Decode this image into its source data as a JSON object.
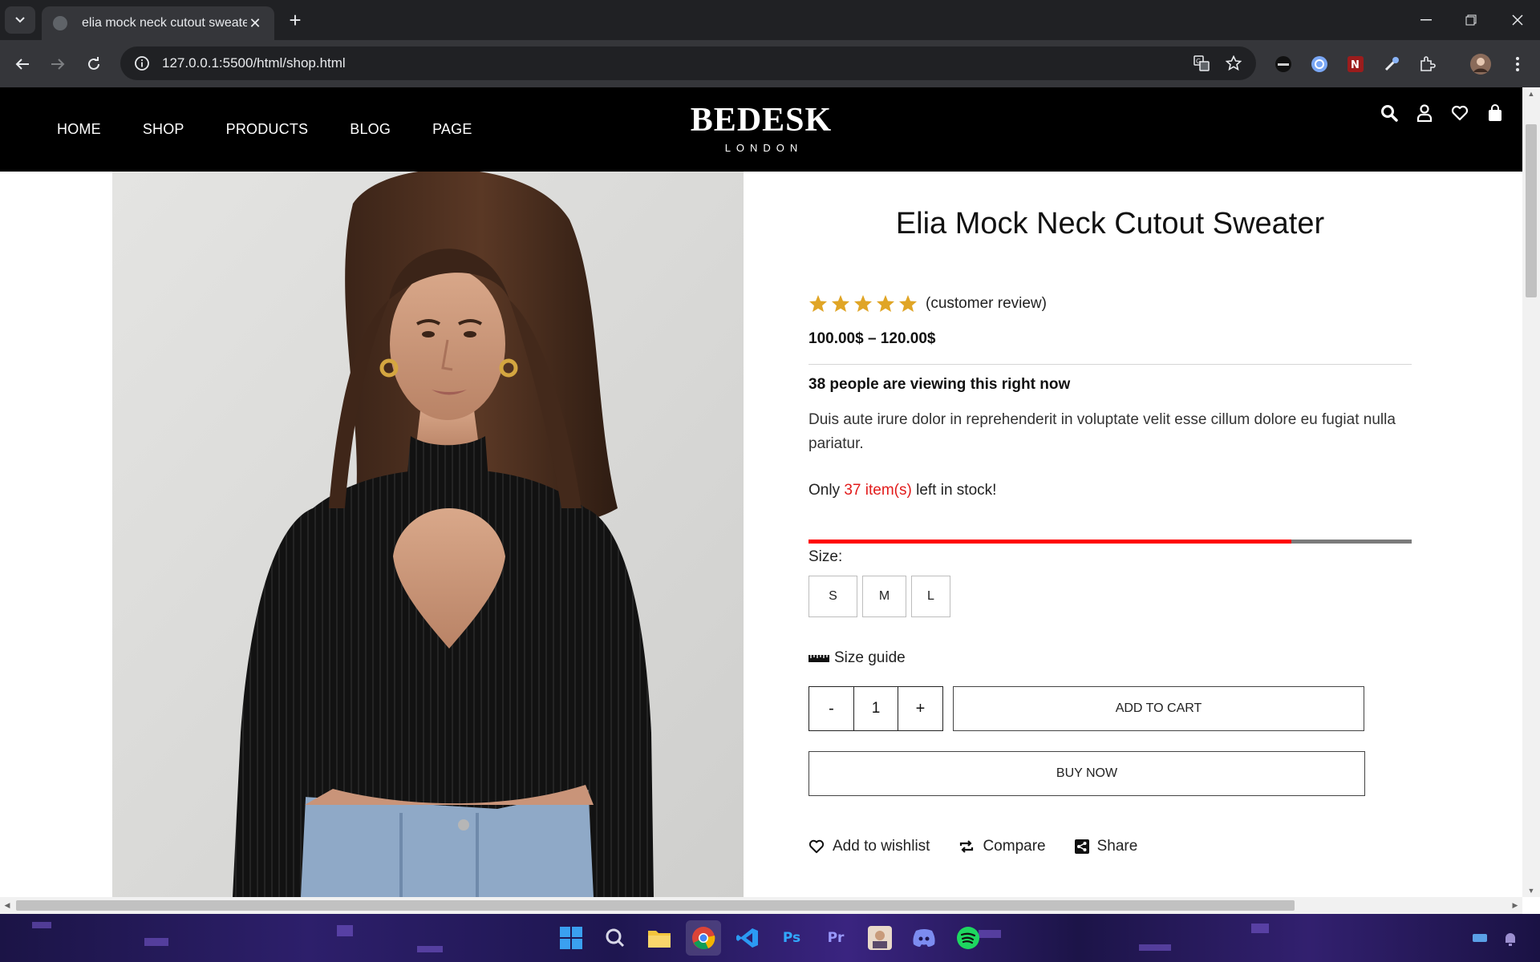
{
  "browser": {
    "tab_title": "elia mock neck cutout sweater",
    "url": "127.0.0.1:5500/html/shop.html"
  },
  "site": {
    "nav": [
      "HOME",
      "SHOP",
      "PRODUCTS",
      "BLOG",
      "PAGE"
    ],
    "logo": {
      "brand": "BEDESK",
      "sub": "LONDON"
    },
    "header_icons": [
      "search-icon",
      "user-icon",
      "heart-icon",
      "bag-icon"
    ]
  },
  "product": {
    "title": "Elia Mock Neck Cutout Sweater",
    "rating_stars": 5,
    "review_text": "(customer review)",
    "price": "100.00$ – 120.00$",
    "viewing": "38 people are viewing this right now",
    "description": "Duis aute irure dolor in reprehenderit in voluptate velit esse cillum dolore eu fugiat nulla pariatur.",
    "stock_prefix": "Only",
    "stock_count": "37 item(s)",
    "stock_suffix": "left in stock!",
    "stock_fraction": 0.8,
    "size_label": "Size:",
    "sizes": [
      "S",
      "M",
      "L"
    ],
    "size_guide": "Size guide",
    "qty_minus": "-",
    "qty_value": "1",
    "qty_plus": "+",
    "add_to_cart": "ADD TO CART",
    "buy_now": "BUY NOW",
    "actions": [
      "Add to wishlist",
      "Compare",
      "Share"
    ]
  },
  "colors": {
    "header_bg": "#000000",
    "star": "#e0a526",
    "stock_red": "#e21b1b"
  },
  "taskbar": {
    "apps": [
      "windows-start-icon",
      "search-icon",
      "file-explorer-icon",
      "chrome-icon",
      "vscode-icon",
      "photoshop-icon",
      "premiere-icon",
      "app-icon",
      "discord-icon",
      "spotify-icon"
    ]
  }
}
